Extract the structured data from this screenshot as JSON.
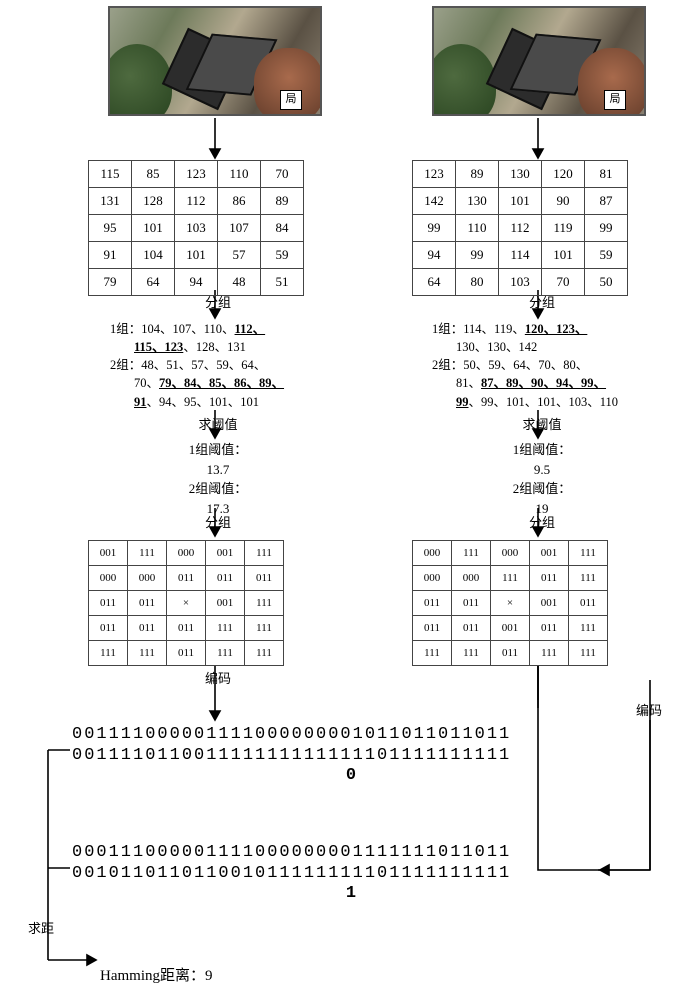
{
  "marker_left": "局",
  "marker_right": "局",
  "matrix_left": [
    [
      "115",
      "85",
      "123",
      "110",
      "70"
    ],
    [
      "131",
      "128",
      "112",
      "86",
      "89"
    ],
    [
      "95",
      "101",
      "103",
      "107",
      "84"
    ],
    [
      "91",
      "104",
      "101",
      "57",
      "59"
    ],
    [
      "79",
      "64",
      "94",
      "48",
      "51"
    ]
  ],
  "matrix_right": [
    [
      "123",
      "89",
      "130",
      "120",
      "81"
    ],
    [
      "142",
      "130",
      "101",
      "90",
      "87"
    ],
    [
      "99",
      "110",
      "112",
      "119",
      "99"
    ],
    [
      "94",
      "99",
      "114",
      "101",
      "59"
    ],
    [
      "64",
      "80",
      "103",
      "70",
      "50"
    ]
  ],
  "step_group": "分组",
  "step_threshold": "求阈值",
  "step_encode_cn": "分组",
  "step_encode_label": "编码",
  "groups_left": {
    "line1_a": "1组：104、107、110、",
    "line1_b": "112、",
    "line2_a": "115、123",
    "line2_b": "、128、131",
    "line3_a": "2组：48、51、57、59、64、",
    "line4_a": "70、",
    "line4_b": "79、84、85、86、89、",
    "line5_a": "91",
    "line5_b": "、94、95、101、101"
  },
  "groups_right": {
    "line1_a": "1组：114、119、",
    "line1_b": "120、123、",
    "line2_a": "130、130、142",
    "line3_a": "2组：50、59、64、70、80、",
    "line4_a": "81、",
    "line4_b": "87、89、90、94、99、",
    "line5_a": "99",
    "line5_b": "、99、101、101、103、110"
  },
  "thr_left_1": "1组阈值：",
  "thr_left_1v": "13.7",
  "thr_left_2": "2组阈值：",
  "thr_left_2v": "17.3",
  "thr_right_1": "1组阈值：",
  "thr_right_1v": "9.5",
  "thr_right_2": "2组阈值：",
  "thr_right_2v": "19",
  "codes_left": [
    [
      "001",
      "111",
      "000",
      "001",
      "111"
    ],
    [
      "000",
      "000",
      "011",
      "011",
      "011"
    ],
    [
      "011",
      "011",
      "×",
      "001",
      "111"
    ],
    [
      "011",
      "011",
      "011",
      "111",
      "111"
    ],
    [
      "111",
      "111",
      "011",
      "111",
      "111"
    ]
  ],
  "codes_right": [
    [
      "000",
      "111",
      "000",
      "001",
      "111"
    ],
    [
      "000",
      "000",
      "111",
      "011",
      "111"
    ],
    [
      "011",
      "011",
      "×",
      "001",
      "011"
    ],
    [
      "011",
      "011",
      "001",
      "011",
      "111"
    ],
    [
      "111",
      "111",
      "011",
      "111",
      "111"
    ]
  ],
  "bin_top_1": "001111000001111000000001011011011011",
  "bin_top_2": "001111011001111111111111101111111111",
  "bin_top_tail": "0",
  "bin_bot_1": "000111000001111000000001111111011011",
  "bin_bot_2": "001011011011001011111111101111111111",
  "bin_bot_tail": "1",
  "dist_label": "求距",
  "final": "Hamming距离：9"
}
